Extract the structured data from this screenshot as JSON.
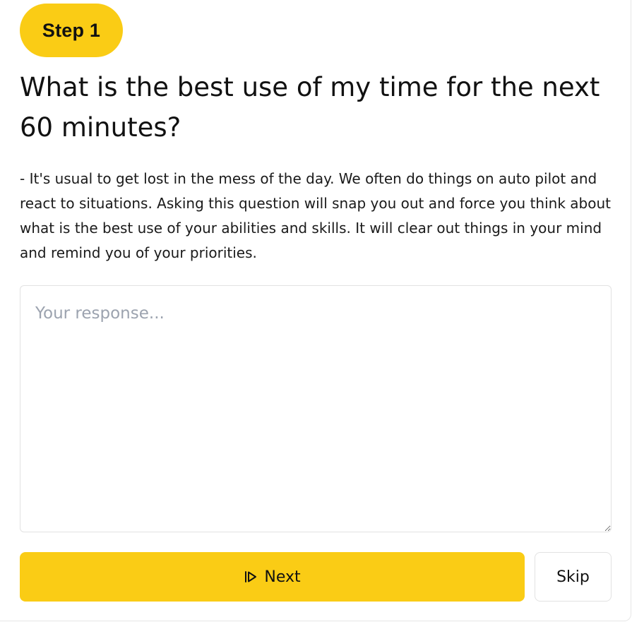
{
  "step": {
    "label": "Step 1"
  },
  "question": {
    "text": "What is the best use of my time for the next 60 minutes?"
  },
  "description": {
    "text": "- It's usual to get lost in the mess of the day. We often do things on auto pilot and react to situations. Asking this question will snap you out and force you think about what is the best use of your abilities and skills. It will clear out things in your mind and remind you of your priorities."
  },
  "response": {
    "placeholder": "Your response...",
    "value": ""
  },
  "actions": {
    "next_label": "Next",
    "next_icon": "play-next-icon",
    "skip_label": "Skip"
  },
  "colors": {
    "accent": "#facc15",
    "placeholder": "#9ca3af",
    "border": "#e2e2e2"
  }
}
